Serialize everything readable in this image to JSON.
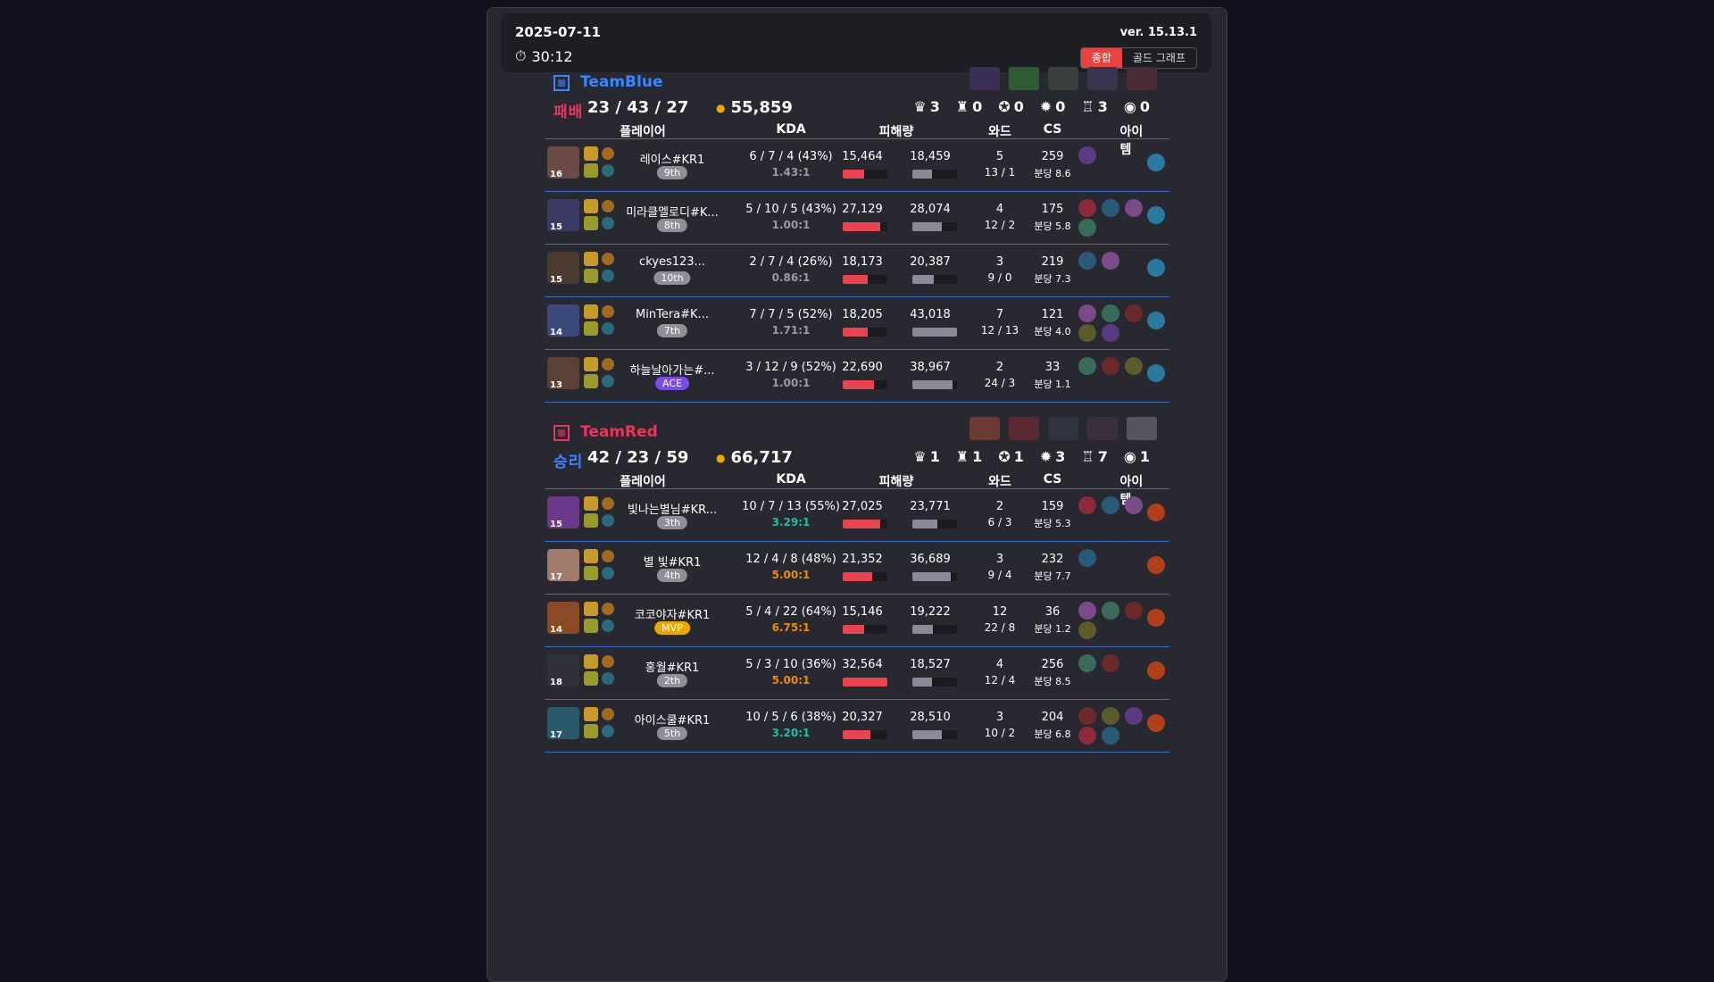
{
  "header": {
    "date": "2025-07-11",
    "duration": "30:12",
    "version": "ver. 15.13.1",
    "tabs": [
      "종합",
      "골드 그래프"
    ]
  },
  "columns": {
    "player": "플레이어",
    "kda": "KDA",
    "damage": "피해량",
    "ward": "와드",
    "cs": "CS",
    "items": "아이템"
  },
  "colors": {
    "blue": "#3a86ff",
    "red": "#e8365d",
    "accent": "#e8433f"
  },
  "teams": [
    {
      "name": "TeamBlue",
      "result": "패배",
      "kda": "23 / 43 / 27",
      "gold": "55,859",
      "objectives": [
        "3",
        "0",
        "0",
        "0",
        "3",
        "0"
      ],
      "players": [
        {
          "level": "16",
          "name": "레이스#KR1",
          "rank": "9th",
          "kda": "6 / 7 / 4 (43%)",
          "ratio": "1.43:1",
          "damage": "15,464",
          "dmg_pct": 0.47,
          "taken": "18,459",
          "tkn_pct": 0.43,
          "wards": "5",
          "ward_detail": "13  /  1",
          "cs": "259",
          "cs_min": "분당 8.6"
        },
        {
          "level": "15",
          "name": "미라클멜로디#K...",
          "rank": "8th",
          "kda": "5 / 10 / 5 (43%)",
          "ratio": "1.00:1",
          "damage": "27,129",
          "dmg_pct": 0.83,
          "taken": "28,074",
          "tkn_pct": 0.65,
          "wards": "4",
          "ward_detail": "12  /  2",
          "cs": "175",
          "cs_min": "분당 5.8"
        },
        {
          "level": "15",
          "name": "ckyes123...",
          "rank": "10th",
          "kda": "2 / 7 / 4 (26%)",
          "ratio": "0.86:1",
          "damage": "18,173",
          "dmg_pct": 0.56,
          "taken": "20,387",
          "tkn_pct": 0.47,
          "wards": "3",
          "ward_detail": "9  /  0",
          "cs": "219",
          "cs_min": "분당 7.3"
        },
        {
          "level": "14",
          "name": "MinTera#K...",
          "rank": "7th",
          "kda": "7 / 7 / 5 (52%)",
          "ratio": "1.71:1",
          "damage": "18,205",
          "dmg_pct": 0.56,
          "taken": "43,018",
          "tkn_pct": 1.0,
          "wards": "7",
          "ward_detail": "12  /  13",
          "cs": "121",
          "cs_min": "분당 4.0"
        },
        {
          "level": "13",
          "name": "하늘날아가는#...",
          "rank": "ACE",
          "kda": "3 / 12 / 9 (52%)",
          "ratio": "1.00:1",
          "damage": "22,690",
          "dmg_pct": 0.7,
          "taken": "38,967",
          "tkn_pct": 0.9,
          "wards": "2",
          "ward_detail": "24  /  3",
          "cs": "33",
          "cs_min": "분당 1.1"
        }
      ]
    },
    {
      "name": "TeamRed",
      "result": "승리",
      "kda": "42 / 23 / 59",
      "gold": "66,717",
      "objectives": [
        "1",
        "1",
        "1",
        "3",
        "7",
        "1"
      ],
      "players": [
        {
          "level": "15",
          "name": "빛나는별님#KR...",
          "rank": "3th",
          "kda": "10 / 7 / 13 (55%)",
          "ratio": "3.29:1",
          "damage": "27,025",
          "dmg_pct": 0.83,
          "taken": "23,771",
          "tkn_pct": 0.55,
          "wards": "2",
          "ward_detail": "6  /  3",
          "cs": "159",
          "cs_min": "분당 5.3"
        },
        {
          "level": "17",
          "name": "별 빛#KR1",
          "rank": "4th",
          "kda": "12 / 4 / 8 (48%)",
          "ratio": "5.00:1",
          "damage": "21,352",
          "dmg_pct": 0.66,
          "taken": "36,689",
          "tkn_pct": 0.85,
          "wards": "3",
          "ward_detail": "9  /  4",
          "cs": "232",
          "cs_min": "분당 7.7"
        },
        {
          "level": "14",
          "name": "코코야자#KR1",
          "rank": "MVP",
          "kda": "5 / 4 / 22 (64%)",
          "ratio": "6.75:1",
          "damage": "15,146",
          "dmg_pct": 0.47,
          "taken": "19,222",
          "tkn_pct": 0.45,
          "wards": "12",
          "ward_detail": "22  /  8",
          "cs": "36",
          "cs_min": "분당 1.2"
        },
        {
          "level": "18",
          "name": "홍월#KR1",
          "rank": "2th",
          "kda": "5 / 3 / 10 (36%)",
          "ratio": "5.00:1",
          "damage": "32,564",
          "dmg_pct": 1.0,
          "taken": "18,527",
          "tkn_pct": 0.43,
          "wards": "4",
          "ward_detail": "12  /  4",
          "cs": "256",
          "cs_min": "분당 8.5"
        },
        {
          "level": "17",
          "name": "아이스쿨#KR1",
          "rank": "5th",
          "kda": "10 / 5 / 6 (38%)",
          "ratio": "3.20:1",
          "damage": "20,327",
          "dmg_pct": 0.62,
          "taken": "28,510",
          "tkn_pct": 0.66,
          "wards": "3",
          "ward_detail": "10  /  2",
          "cs": "204",
          "cs_min": "분당 6.8"
        }
      ]
    }
  ]
}
